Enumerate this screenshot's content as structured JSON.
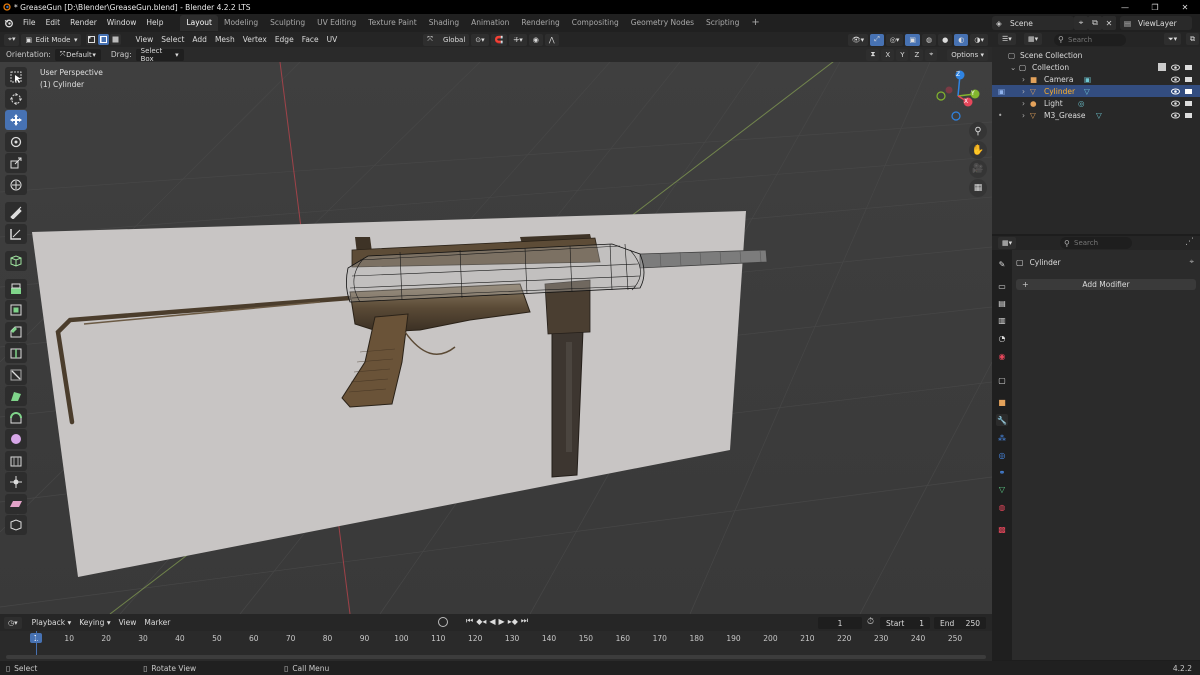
{
  "window": {
    "title": "* GreaseGun [D:\\Blender\\GreaseGun.blend] - Blender 4.2.2 LTS",
    "minimize": "—",
    "maximize": "❐",
    "close": "✕"
  },
  "menu": [
    "File",
    "Edit",
    "Render",
    "Window",
    "Help"
  ],
  "workspaces": [
    "Layout",
    "Modeling",
    "Sculpting",
    "UV Editing",
    "Texture Paint",
    "Shading",
    "Animation",
    "Rendering",
    "Compositing",
    "Geometry Nodes",
    "Scripting"
  ],
  "active_workspace": "Layout",
  "add_workspace": "+",
  "scene": {
    "name": "Scene",
    "view_layer": "ViewLayer"
  },
  "viewport_header": {
    "mode": "Edit Mode",
    "menus": [
      "View",
      "Select",
      "Add",
      "Mesh",
      "Vertex",
      "Edge",
      "Face",
      "UV"
    ],
    "transform_orientation": "Global",
    "options": "Options",
    "axes": [
      "X",
      "Y",
      "Z"
    ]
  },
  "tool_header": {
    "orientation_label": "Orientation:",
    "orientation_value": "Default",
    "drag_label": "Drag:",
    "drag_value": "Select Box"
  },
  "viewport": {
    "perspective": "User Perspective",
    "object": "(1) Cylinder",
    "gizmo": {
      "x": "X",
      "y": "Y",
      "z": "Z"
    }
  },
  "outliner": {
    "search_placeholder": "Search",
    "root": "Scene Collection",
    "collection": "Collection",
    "items": [
      {
        "name": "Camera",
        "selected": false
      },
      {
        "name": "Cylinder",
        "selected": true
      },
      {
        "name": "Light",
        "selected": false
      },
      {
        "name": "M3_Grease",
        "selected": false
      }
    ]
  },
  "properties": {
    "search_placeholder": "Search",
    "object_name": "Cylinder",
    "add_modifier": "Add Modifier",
    "tab_icons": [
      "tool-icon",
      "render-icon",
      "output-icon",
      "view-layer-icon",
      "scene-icon",
      "world-icon",
      "collection-icon",
      "object-icon",
      "modifier-icon",
      "particles-icon",
      "physics-icon",
      "constraints-icon",
      "data-icon",
      "material-icon",
      "texture-icon"
    ],
    "active_tab": "modifier-icon"
  },
  "timeline": {
    "menus": [
      "Playback",
      "Keying",
      "View",
      "Marker"
    ],
    "current_frame": "1",
    "start_label": "Start",
    "start": "1",
    "end_label": "End",
    "end": "250",
    "ticks": [
      "1",
      "10",
      "20",
      "30",
      "40",
      "50",
      "60",
      "70",
      "80",
      "90",
      "100",
      "110",
      "120",
      "130",
      "140",
      "150",
      "160",
      "170",
      "180",
      "190",
      "200",
      "210",
      "220",
      "230",
      "240",
      "250"
    ]
  },
  "statusbar": {
    "select": "Select",
    "rotate": "Rotate View",
    "call_menu": "Call Menu",
    "version": "4.2.2"
  },
  "colors": {
    "accent": "#4772b3",
    "selected_row": "#334d80",
    "viewport_bg": "#3d3d3d",
    "axis_x": "#e6475b",
    "axis_y": "#82b52e",
    "axis_z": "#2f84e3"
  }
}
